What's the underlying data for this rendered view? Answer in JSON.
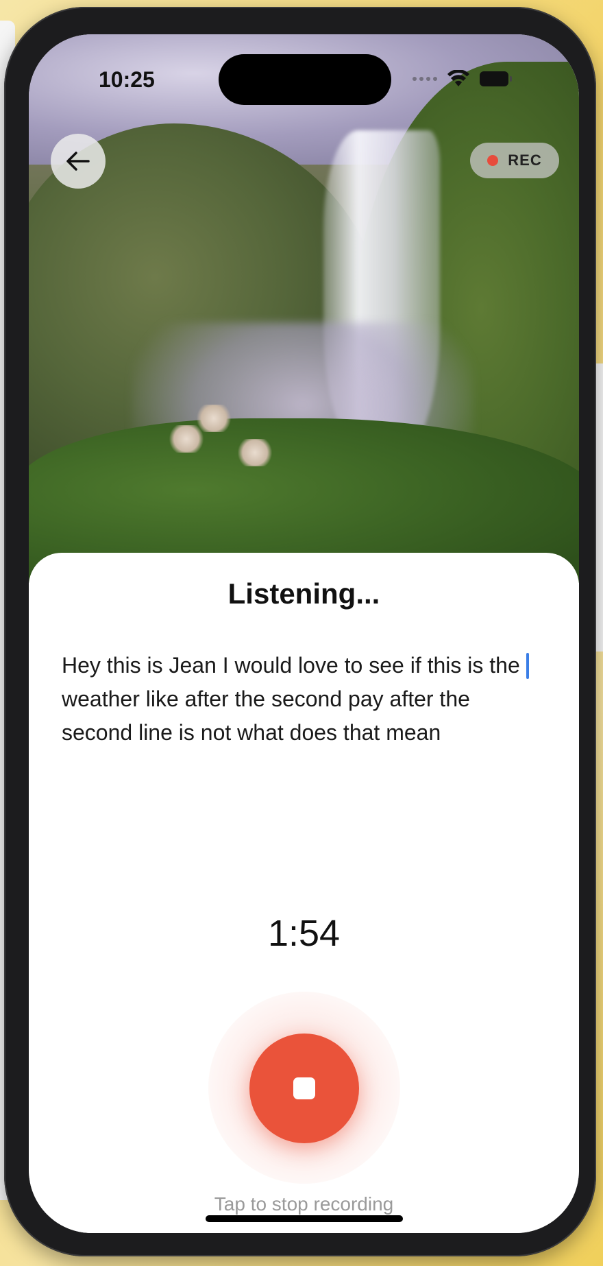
{
  "status_bar": {
    "time": "10:25"
  },
  "header": {
    "back_icon": "arrow-left-icon",
    "rec_label": "REC",
    "rec_color": "#e74c3c"
  },
  "sheet": {
    "title": "Listening...",
    "transcript": "Hey this is Jean I would love to see if this is the weather like after the second pay after the second line is not what does that mean",
    "timer": "1:54",
    "stop_button_icon": "stop-icon",
    "stop_button_color": "#ea533a",
    "hint": "Tap to stop recording"
  }
}
